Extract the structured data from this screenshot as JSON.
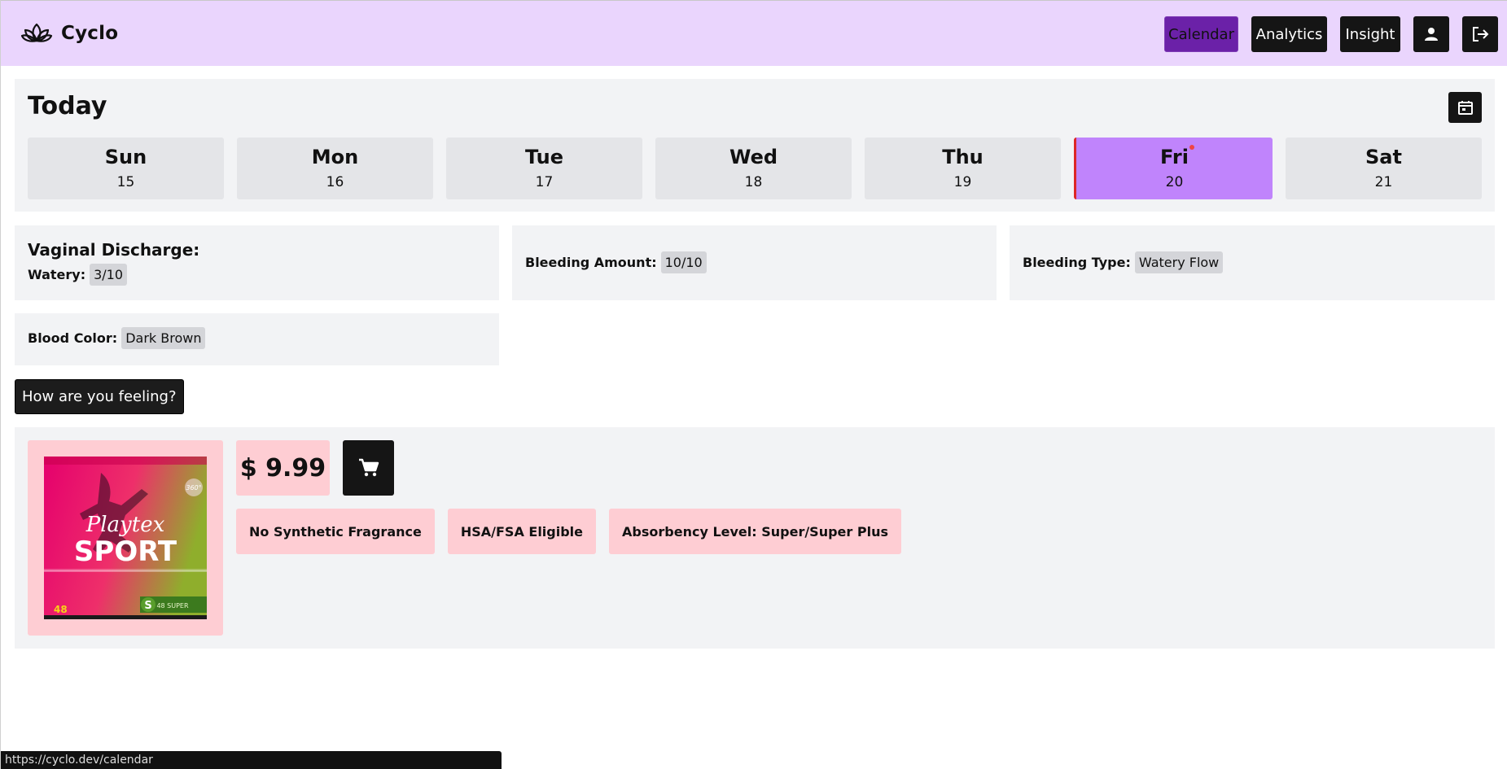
{
  "app": {
    "name": "Cyclo"
  },
  "nav": {
    "calendar": "Calendar",
    "analytics": "Analytics",
    "insight": "Insight",
    "profile_icon": "user-icon",
    "logout_icon": "logout-icon",
    "active": "Calendar",
    "active_color": "#6b21a8"
  },
  "week": {
    "title": "Today",
    "calendar_icon": "calendar-icon",
    "days": [
      {
        "name": "Sun",
        "date": "15"
      },
      {
        "name": "Mon",
        "date": "16"
      },
      {
        "name": "Tue",
        "date": "17"
      },
      {
        "name": "Wed",
        "date": "18"
      },
      {
        "name": "Thu",
        "date": "19"
      },
      {
        "name": "Fri",
        "date": "20"
      },
      {
        "name": "Sat",
        "date": "21"
      }
    ],
    "selected_day": "Fri",
    "selected_color": "#c084fc"
  },
  "log": {
    "discharge_heading": "Vaginal Discharge:",
    "discharge_label": "Watery:",
    "discharge_value": "3/10",
    "bleeding_amount_label": "Bleeding Amount:",
    "bleeding_amount_value": "10/10",
    "bleeding_type_label": "Bleeding Type:",
    "bleeding_type_value": "Watery Flow",
    "blood_color_label": "Blood Color:",
    "blood_color_value": "Dark Brown"
  },
  "feeling_button": "How are you feeling?",
  "product": {
    "brand": "Playtex",
    "line": "SPORT",
    "badge": "360°",
    "count": "48",
    "size_letter": "S",
    "size_text": "48 SUPER",
    "price": "$ 9.99",
    "cart_icon": "cart-icon",
    "tags": [
      "No Synthetic Fragrance",
      "HSA/FSA Eligible",
      "Absorbency Level: Super/Super Plus"
    ]
  },
  "status_url": "https://cyclo.dev/calendar"
}
